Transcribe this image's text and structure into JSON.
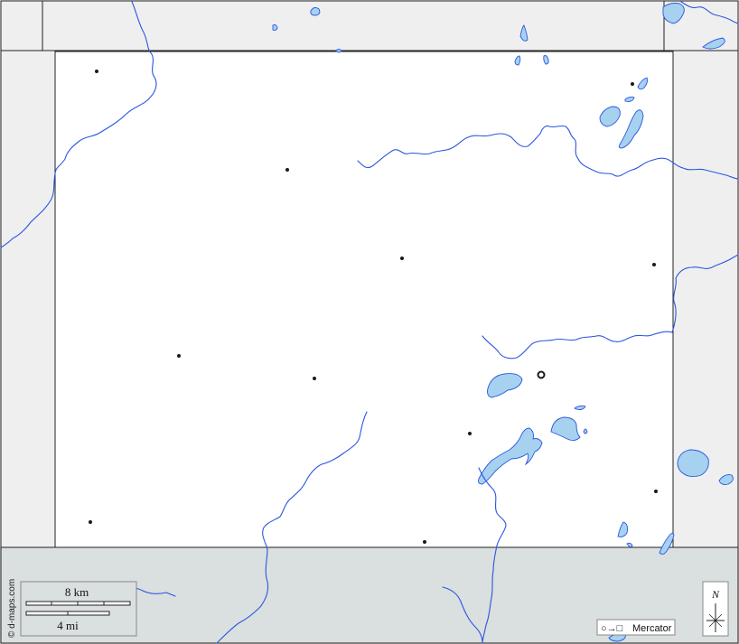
{
  "map": {
    "projection_label": "Mercator",
    "projection_glyph": "○→□",
    "north_label": "N",
    "copyright": "© d-maps.com",
    "scale": {
      "km_label": "8 km",
      "mi_label": "4 mi"
    },
    "colors": {
      "water": "#a6d2f0",
      "water_stroke": "#2b57e0",
      "neighbor_land": "#efefef",
      "bottom_region": "#dadfdf",
      "focus_land": "#ffffff",
      "border": "#222222"
    }
  }
}
